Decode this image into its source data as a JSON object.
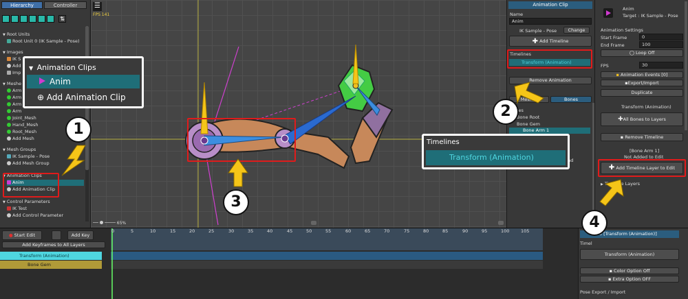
{
  "left": {
    "tabs": [
      "Hierarchy",
      "Controller"
    ],
    "rows": [
      {
        "label": "Root Units",
        "kind": "header"
      },
      {
        "label": "Root Unit 0 (IK Sample - Pose)",
        "kind": "item"
      },
      {
        "label": "Images",
        "kind": "header"
      },
      {
        "label": "IK S",
        "kind": "item"
      },
      {
        "label": "Add",
        "kind": "item"
      },
      {
        "label": "Imp",
        "kind": "item"
      },
      {
        "label": "Meshe",
        "kind": "header"
      },
      {
        "label": "Arm",
        "kind": "item"
      },
      {
        "label": "Arm",
        "kind": "item"
      },
      {
        "label": "Arm",
        "kind": "item"
      },
      {
        "label": "Arm",
        "kind": "item"
      },
      {
        "label": "Joint_Mesh",
        "kind": "item"
      },
      {
        "label": "Hand_Mesh",
        "kind": "item"
      },
      {
        "label": "Root_Mesh",
        "kind": "item"
      },
      {
        "label": "Add Mesh",
        "kind": "item"
      },
      {
        "label": "Mesh Groups",
        "kind": "header"
      },
      {
        "label": "IK Sample - Pose",
        "kind": "item"
      },
      {
        "label": "Add Mesh Group",
        "kind": "item"
      },
      {
        "label": "Animation Clips",
        "kind": "header"
      },
      {
        "label": "Anim",
        "kind": "selected"
      },
      {
        "label": "Add Animation Clip",
        "kind": "item"
      },
      {
        "label": "Control Parameters",
        "kind": "header"
      },
      {
        "label": "IK Test",
        "kind": "item"
      },
      {
        "label": "Add Control Parameter",
        "kind": "item"
      }
    ]
  },
  "viewport": {
    "fps": "FPS 141",
    "zoom": "65%"
  },
  "popup_clips": {
    "header": "Animation Clips",
    "selected": "Anim",
    "add": "Add Animation Clip"
  },
  "popup_timelines": {
    "header": "Timelines",
    "item": "Transform (Animation)"
  },
  "mid": {
    "title": "Animation Clip",
    "name_label": "Name",
    "name_value": "Anim",
    "target": "IK Sample - Pose",
    "change": "Change",
    "add_timeline": "Add Timeline",
    "timelines_label": "Timelines",
    "timeline_item": "Transform (Animation)",
    "remove_anim": "Remove Animation",
    "tab_meshes": "Meshes",
    "tab_bones": "Bones",
    "bones_label": "Bones",
    "bone_root": "Bone Root",
    "bone_gem": "Bone Gem",
    "bone_arm": "Bone Arm 1",
    "end": "End"
  },
  "right": {
    "name": "Anim",
    "target": "Target : IK Sample - Pose",
    "settings": "Animation Settings",
    "start_label": "Start Frame",
    "start_value": "0",
    "end_label": "End Frame",
    "end_value": "100",
    "loop": "Loop Off",
    "fps_label": "FPS",
    "fps_value": "30",
    "events": "Animation Events [0]",
    "export": "Export/Import",
    "duplicate": "Duplicate",
    "timeline": "Transform (Animation)",
    "all_bones": "All Bones to Layers",
    "remove_timeline": "Remove Timeline",
    "bone_sel": "[Bone Arm 1]",
    "not_added": "Not Added to Edit",
    "add_layer": "Add Timeline Layer to Edit",
    "layers": "Timeline Layers"
  },
  "bottom": {
    "start_edit": "Start Edit",
    "add_key": "Add Key",
    "add_keyframes": "Add Keyframes to All Layers",
    "track_timeline": "Transform (Animation)",
    "track_bone": "Bone Gem",
    "ruler": [
      "0",
      "5",
      "10",
      "15",
      "20",
      "25",
      "30",
      "35",
      "40",
      "45",
      "50",
      "55",
      "60",
      "65",
      "70",
      "75",
      "80",
      "85",
      "90",
      "95",
      "100",
      "105"
    ],
    "panel_title": "e [Transform (Animation)]",
    "panel_label": "Timel",
    "panel_btn": "Transform (Animation)",
    "color_opt": "Color Option Off",
    "extra_opt": "Extra Option OFF",
    "pose_export": "Pose Export / Import"
  },
  "steps": [
    "1",
    "2",
    "3",
    "4"
  ],
  "colors": {
    "accent": "#1f6e78",
    "highlight": "#e01b1b",
    "arrow": "#f5c518",
    "timeline_cyan": "#4fd6e0"
  }
}
